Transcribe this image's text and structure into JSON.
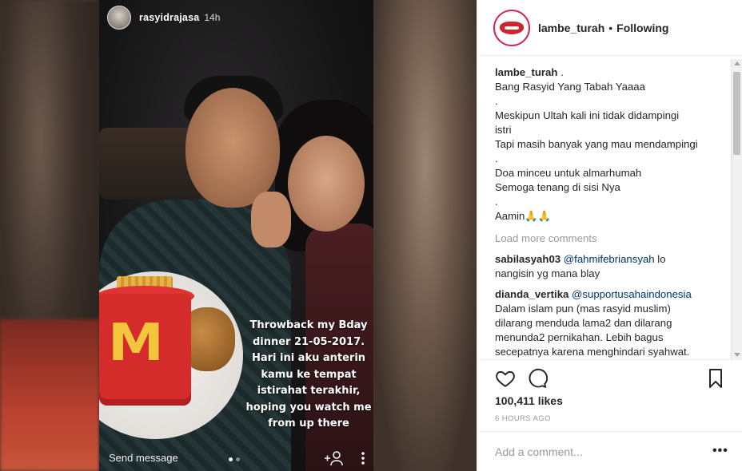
{
  "story": {
    "username": "rasyidrajasa",
    "time": "14h",
    "caption_lines": [
      "Throwback my Bday",
      "dinner 21-05-2017.",
      "Hari ini aku anterin",
      "kamu ke tempat",
      "istirahat terakhir,",
      "hoping you watch me",
      "from up there"
    ],
    "send_message": "Send message",
    "page_dots": 2,
    "active_dot": 0
  },
  "post": {
    "username": "lambe_turah",
    "separator": "•",
    "follow_status": "Following",
    "caption_user": "lambe_turah",
    "caption_lines": [
      " .",
      "Bang Rasyid Yang Tabah Yaaaa",
      ".",
      "Meskipun Ultah kali ini tidak didampingi",
      "istri",
      "Tapi masih banyak yang mau mendampingi",
      ".",
      "Doa minceu untuk almarhumah",
      "Semoga tenang di sisi Nya",
      ".",
      "Aamin🙏🙏"
    ],
    "load_more": "Load more comments",
    "comments": [
      {
        "user": "sabilasyah03",
        "mention": "@fahmifebriansyah",
        "first_rest": " lo",
        "lines": [
          "nangisin yg mana blay"
        ]
      },
      {
        "user": "dianda_vertika",
        "mention": "@supportusahaindonesia",
        "first_rest": "",
        "lines": [
          "Dalam islam pun (mas rasyid muslim)",
          "dilarang menduda lama2 dan dilarang",
          "menunda2 pernikahan. Lebih bagus",
          "secepatnya karena menghindari syahwat."
        ]
      }
    ],
    "likes": "100,411 likes",
    "time_ago": "6 HOURS AGO",
    "add_comment_placeholder": "Add a comment...",
    "more": "•••"
  },
  "icons": {
    "heart": "heart-icon",
    "comment": "comment-icon",
    "save": "bookmark-icon",
    "add_person": "add-person-icon",
    "more_vertical": "more-vertical-icon"
  },
  "colors": {
    "mention": "#003569",
    "muted": "#999999",
    "text": "#262626",
    "brand_ring": "#d1264f"
  }
}
